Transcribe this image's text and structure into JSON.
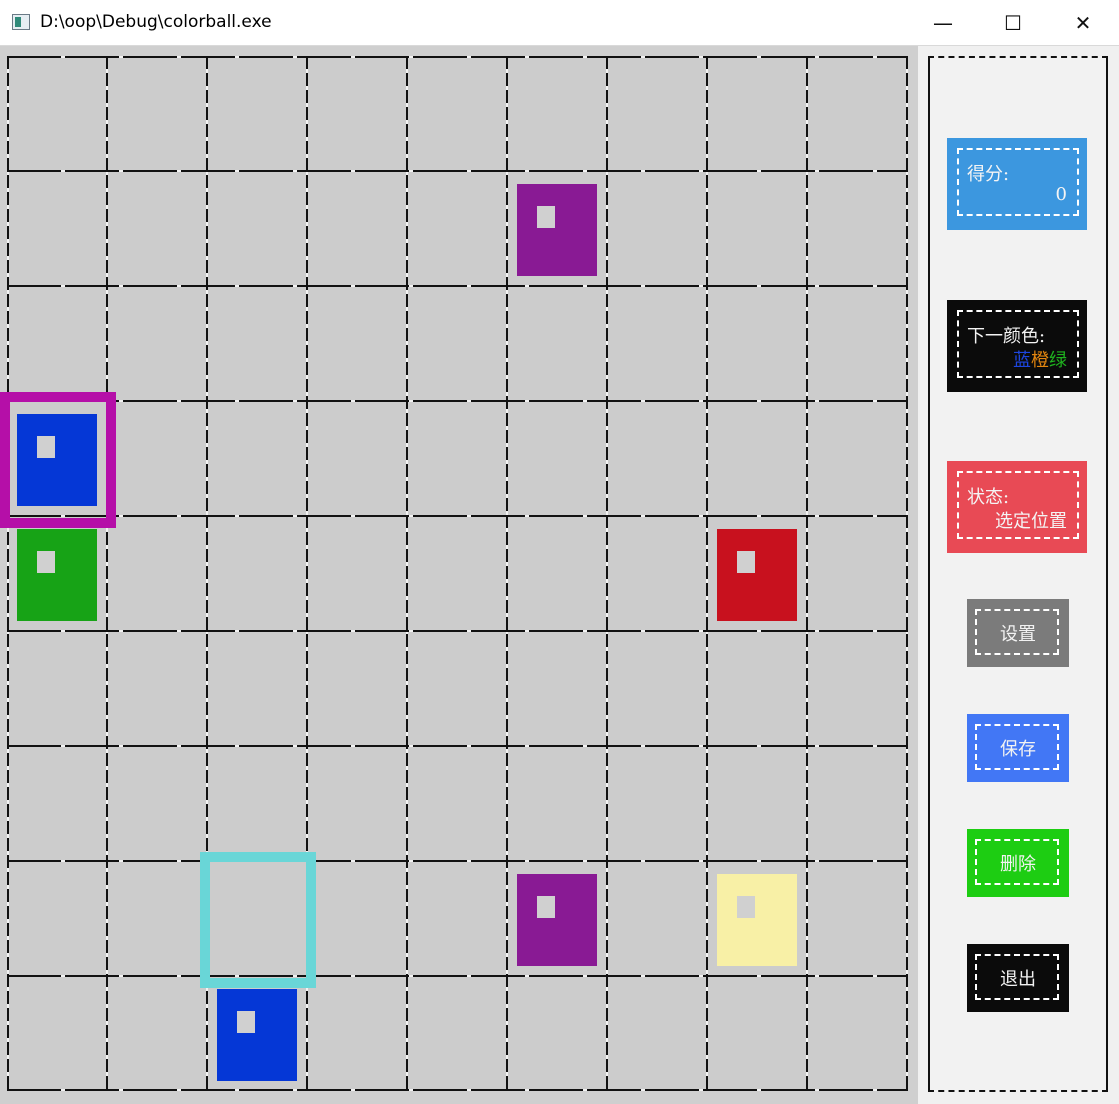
{
  "window": {
    "title": "D:\\oop\\Debug\\colorball.exe",
    "controls": {
      "minimize": "—",
      "maximize": "☐",
      "close": "✕"
    }
  },
  "board": {
    "cols": 9,
    "rows": 9,
    "background": "#cccccc",
    "balls": [
      {
        "row": 1,
        "col": 5,
        "color": "#891a94"
      },
      {
        "row": 3,
        "col": 0,
        "color": "#0537d6"
      },
      {
        "row": 4,
        "col": 0,
        "color": "#17a316"
      },
      {
        "row": 4,
        "col": 7,
        "color": "#c8111e"
      },
      {
        "row": 7,
        "col": 5,
        "color": "#891a94"
      },
      {
        "row": 7,
        "col": 7,
        "color": "#f8f0a6"
      },
      {
        "row": 8,
        "col": 2,
        "color": "#0537d6"
      }
    ],
    "selections": [
      {
        "row": 3,
        "col": 0,
        "color": "#b50fa8"
      },
      {
        "row": 7,
        "col": 2,
        "color": "#69d6d7"
      }
    ]
  },
  "panel": {
    "score": {
      "label": "得分:",
      "value": "0",
      "bg": "#3c97df"
    },
    "next_colors": {
      "label": "下一颜色:",
      "bg": "#0b0b0b",
      "colors": [
        {
          "name": "蓝",
          "hex": "#1d46e0"
        },
        {
          "name": "橙",
          "hex": "#e3860f"
        },
        {
          "name": "绿",
          "hex": "#1fb21f"
        }
      ]
    },
    "status": {
      "label": "状态:",
      "value": "选定位置",
      "bg": "#e84a55"
    },
    "buttons": {
      "settings": {
        "label": "设置",
        "bg": "#7b7b7b"
      },
      "save": {
        "label": "保存",
        "bg": "#4277f5"
      },
      "delete": {
        "label": "删除",
        "bg": "#1dcd12"
      },
      "exit": {
        "label": "退出",
        "bg": "#0b0b0b"
      }
    }
  }
}
